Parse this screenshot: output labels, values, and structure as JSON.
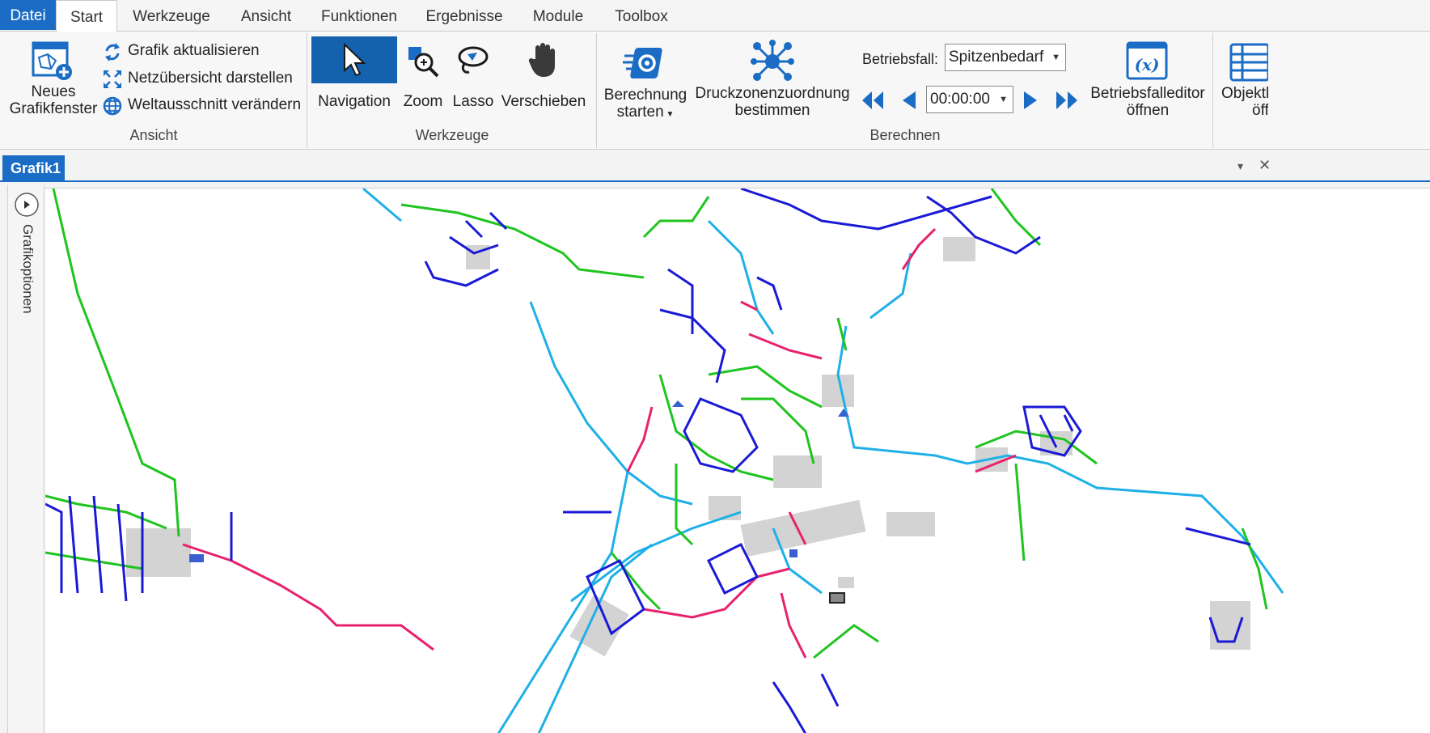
{
  "menu_tabs": [
    "Datei",
    "Start",
    "Werkzeuge",
    "Ansicht",
    "Funktionen",
    "Ergebnisse",
    "Module",
    "Toolbox"
  ],
  "ribbon": {
    "ansicht": {
      "new_window_line1": "Neues",
      "new_window_line2": "Grafikfenster",
      "refresh": "Grafik aktualisieren",
      "overview": "Netzübersicht darstellen",
      "world": "Weltausschnitt verändern",
      "group_label": "Ansicht"
    },
    "werkzeuge": {
      "navigation": "Navigation",
      "zoom": "Zoom",
      "lasso": "Lasso",
      "pan": "Verschieben",
      "group_label": "Werkzeuge"
    },
    "berechnen": {
      "calc_line1": "Berechnung",
      "calc_line2": "starten",
      "pressure_line1": "Druckzonenzuordnung",
      "pressure_line2": "bestimmen",
      "case_label": "Betriebsfall:",
      "case_value": "Spitzenbedarf",
      "time_value": "00:00:00",
      "editor_line1": "Betriebsfalleditor",
      "editor_line2": "öffnen",
      "group_label": "Berechnen"
    },
    "objekt": {
      "line1": "Objektl",
      "line2": "öff"
    }
  },
  "document": {
    "tab_title": "Grafik1",
    "side_panel_label": "Grafikoptionen"
  },
  "colors": {
    "accent": "#1b6cc4",
    "pipe_green": "#1fc41f",
    "pipe_blue": "#1a1ad6",
    "pipe_cyan": "#1eb0e6",
    "pipe_red": "#e8216e",
    "building_gray": "#d0d0d0"
  }
}
